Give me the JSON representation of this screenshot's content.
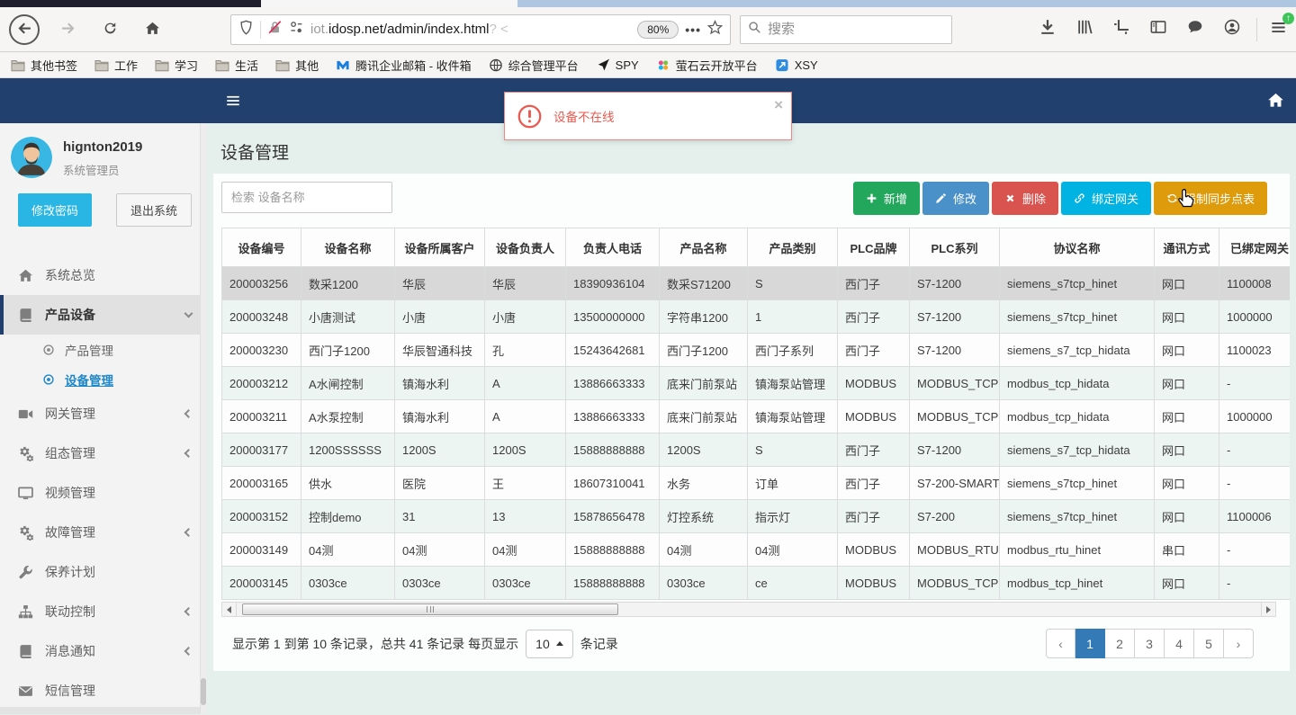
{
  "browser": {
    "url": {
      "prefix": "iot.",
      "domain": "idosp.net",
      "path": "/admin/index.html",
      "trail": "?  <"
    },
    "zoom_badge": "80%",
    "search_placeholder": "搜索",
    "bookmarks": [
      {
        "id": "other-bookmarks",
        "icon": "folder",
        "label": "其他书签"
      },
      {
        "id": "work",
        "icon": "folder",
        "label": "工作"
      },
      {
        "id": "study",
        "icon": "folder",
        "label": "学习"
      },
      {
        "id": "life",
        "icon": "folder",
        "label": "生活"
      },
      {
        "id": "misc",
        "icon": "folder",
        "label": "其他"
      },
      {
        "id": "tencent-exmail",
        "icon": "tencent",
        "label": "腾讯企业邮箱 - 收件箱"
      },
      {
        "id": "mgmt-platform",
        "icon": "globe",
        "label": "综合管理平台"
      },
      {
        "id": "spy",
        "icon": "plane",
        "label": "SPY"
      },
      {
        "id": "ys7-open-platform",
        "icon": "dots",
        "label": "萤石云开放平台"
      },
      {
        "id": "xsy",
        "icon": "xsy",
        "label": "XSY"
      }
    ]
  },
  "app": {
    "alert": {
      "text": "设备不在线"
    },
    "sidebar": {
      "user": {
        "name": "hignton2019",
        "role": "系统管理员"
      },
      "buttons": {
        "change_password": "修改密码",
        "logout": "退出系统"
      },
      "menu": [
        {
          "id": "system-overview",
          "icon": "home",
          "label": "系统总览",
          "chevron": null
        },
        {
          "id": "product-device",
          "icon": "book",
          "label": "产品设备",
          "chevron": "down",
          "active": true,
          "children": [
            {
              "id": "product-mgmt",
              "label": "产品管理",
              "active": false
            },
            {
              "id": "device-mgmt",
              "label": "设备管理",
              "active": true
            }
          ]
        },
        {
          "id": "gateway-mgmt",
          "icon": "video",
          "label": "网关管理",
          "chevron": "left"
        },
        {
          "id": "config-mgmt",
          "icon": "gears",
          "label": "组态管理",
          "chevron": "left"
        },
        {
          "id": "video-mgmt",
          "icon": "monitor",
          "label": "视频管理",
          "chevron": null
        },
        {
          "id": "fault-mgmt",
          "icon": "gears",
          "label": "故障管理",
          "chevron": "left"
        },
        {
          "id": "maintenance-plan",
          "icon": "wrench",
          "label": "保养计划",
          "chevron": null
        },
        {
          "id": "linkage-control",
          "icon": "sitemap",
          "label": "联动控制",
          "chevron": "left"
        },
        {
          "id": "message-notify",
          "icon": "book",
          "label": "消息通知",
          "chevron": "left"
        },
        {
          "id": "sms-mgmt",
          "icon": "envelope",
          "label": "短信管理",
          "chevron": null
        }
      ]
    },
    "main": {
      "title": "设备管理",
      "search_placeholder": "检索 设备名称",
      "toolbar": [
        {
          "id": "add",
          "icon": "plus",
          "label": "新增",
          "color": "#22a75c"
        },
        {
          "id": "edit",
          "icon": "pencil",
          "label": "修改",
          "color": "#4a90c9"
        },
        {
          "id": "delete",
          "icon": "x",
          "label": "删除",
          "color": "#d9534f"
        },
        {
          "id": "bind-gateway",
          "icon": "link",
          "label": "绑定网关",
          "color": "#00b3e3"
        },
        {
          "id": "force-sync",
          "icon": "refresh",
          "label": "强制同步点表",
          "color": "#de9b0c"
        }
      ],
      "table": {
        "headers": [
          "设备编号",
          "设备名称",
          "设备所属客户",
          "设备负责人",
          "负责人电话",
          "产品名称",
          "产品类别",
          "PLC品牌",
          "PLC系列",
          "协议名称",
          "通讯方式",
          "已绑定网关"
        ],
        "selected_row_index": 0,
        "rows": [
          [
            "200003256",
            "数采1200",
            "华辰",
            "华辰",
            "18390936104",
            "数采S71200",
            "S",
            "西门子",
            "S7-1200",
            "siemens_s7tcp_hinet",
            "网口",
            "1100008"
          ],
          [
            "200003248",
            "小唐测试",
            "小唐",
            "小唐",
            "13500000000",
            "字符串1200",
            "1",
            "西门子",
            "S7-1200",
            "siemens_s7tcp_hinet",
            "网口",
            "1000000"
          ],
          [
            "200003230",
            "西门子1200",
            "华辰智通科技",
            "孔",
            "15243642681",
            "西门子1200",
            "西门子系列",
            "西门子",
            "S7-1200",
            "siemens_s7_tcp_hidata",
            "网口",
            "1100023"
          ],
          [
            "200003212",
            "A水闸控制",
            "镇海水利",
            "A",
            "13886663333",
            "底来门前泵站",
            "镇海泵站管理",
            "MODBUS",
            "MODBUS_TCP",
            "modbus_tcp_hidata",
            "网口",
            "-"
          ],
          [
            "200003211",
            "A水泵控制",
            "镇海水利",
            "A",
            "13886663333",
            "底来门前泵站",
            "镇海泵站管理",
            "MODBUS",
            "MODBUS_TCP",
            "modbus_tcp_hidata",
            "网口",
            "1000000"
          ],
          [
            "200003177",
            "1200SSSSSS",
            "1200S",
            "1200S",
            "15888888888",
            "1200S",
            "S",
            "西门子",
            "S7-1200",
            "siemens_s7_tcp_hidata",
            "网口",
            "-"
          ],
          [
            "200003165",
            "供水",
            "医院",
            "王",
            "18607310041",
            "水务",
            "订单",
            "西门子",
            "S7-200-SMART",
            "siemens_s7tcp_hinet",
            "网口",
            "-"
          ],
          [
            "200003152",
            "控制demo",
            "31",
            "13",
            "15878656478",
            "灯控系统",
            "指示灯",
            "西门子",
            "S7-200",
            "siemens_s7tcp_hinet",
            "网口",
            "1100006"
          ],
          [
            "200003149",
            "04测",
            "04测",
            "04测",
            "15888888888",
            "04测",
            "04测",
            "MODBUS",
            "MODBUS_RTU",
            "modbus_rtu_hinet",
            "串口",
            "-"
          ],
          [
            "200003145",
            "0303ce",
            "0303ce",
            "0303ce",
            "15888888888",
            "0303ce",
            "ce",
            "MODBUS",
            "MODBUS_TCP",
            "modbus_tcp_hinet",
            "网口",
            "-"
          ]
        ]
      },
      "pagination": {
        "summary_prefix": "显示第 1 到第 10 条记录，总共 41 条记录 每页显示",
        "page_size": "10",
        "summary_suffix": "条记录",
        "prev": "‹",
        "next": "›",
        "pages": [
          "1",
          "2",
          "3",
          "4",
          "5"
        ],
        "active_page": "1"
      }
    },
    "colors": {
      "navbar": "#21406e",
      "alert_red": "#e8594f",
      "active_page_blue": "#337ab7",
      "link_blue": "#1e87c9"
    }
  }
}
